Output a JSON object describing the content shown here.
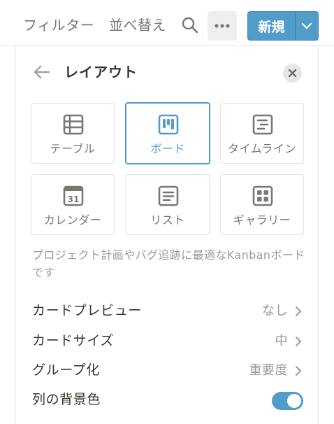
{
  "toolbar": {
    "filter_label": "フィルター",
    "sort_label": "並べ替え",
    "search_icon": "search-icon",
    "more_icon": "more-horizontal-icon",
    "new_label": "新規",
    "new_dropdown_icon": "chevron-down-icon"
  },
  "panel": {
    "back_icon": "arrow-left-icon",
    "title": "レイアウト",
    "close_icon": "close-icon",
    "layouts": [
      {
        "label": "テーブル",
        "icon": "table-icon",
        "selected": false
      },
      {
        "label": "ボード",
        "icon": "board-icon",
        "selected": true
      },
      {
        "label": "タイムライン",
        "icon": "timeline-icon",
        "selected": false
      },
      {
        "label": "カレンダー",
        "icon": "calendar-icon",
        "calendar_day": "31",
        "selected": false
      },
      {
        "label": "リスト",
        "icon": "list-icon",
        "selected": false
      },
      {
        "label": "ギャラリー",
        "icon": "gallery-icon",
        "selected": false
      }
    ],
    "description": "プロジェクト計画やバグ追跡に最適なKanbanボードです",
    "settings": {
      "card_preview": {
        "label": "カードプレビュー",
        "value": "なし"
      },
      "card_size": {
        "label": "カードサイズ",
        "value": "中"
      },
      "group_by": {
        "label": "グループ化",
        "value": "重要度"
      },
      "column_background": {
        "label": "列の背景色",
        "enabled": true
      }
    }
  },
  "colors": {
    "accent": "#529cca",
    "text": "#37352f",
    "muted": "#9b9a97",
    "border": "#e3e2e0"
  }
}
